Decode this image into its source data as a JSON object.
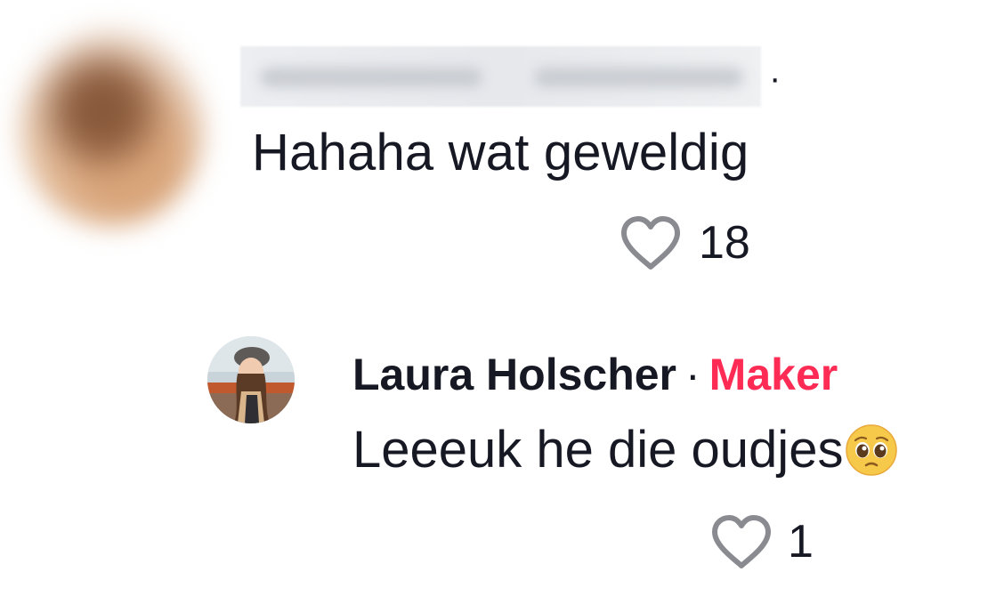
{
  "comments": [
    {
      "username": "",
      "separator": "·",
      "text": "Hahaha wat geweldig",
      "likes": "18",
      "icon": "heart-outline-icon"
    }
  ],
  "reply": {
    "author": "Laura Holscher",
    "separator": "·",
    "badge": "Maker",
    "text": "Leeeuk he die oudjes",
    "emoji": "pleading-face-emoji",
    "likes": "1",
    "icon": "heart-outline-icon"
  },
  "colors": {
    "text": "#161823",
    "badge": "#fe2c55",
    "icon": "#8a8b91"
  }
}
